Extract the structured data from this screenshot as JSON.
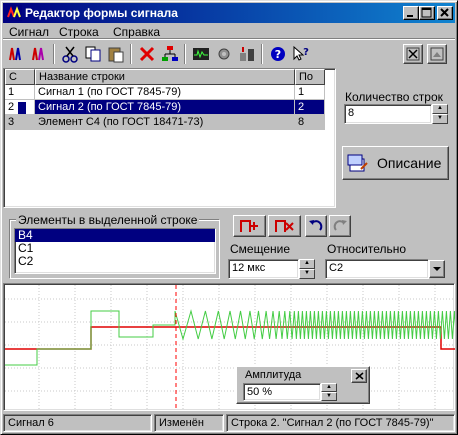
{
  "window": {
    "title": "Редактор формы сигнала"
  },
  "menu": [
    "Сигнал",
    "Строка",
    "Справка"
  ],
  "toolbar": {
    "icons": [
      "signal-add-icon",
      "signal-delete-icon",
      "cut-icon",
      "copy-icon",
      "paste-icon",
      "delete-icon",
      "tree-icon",
      "oscilloscope-icon",
      "settings-icon",
      "export-icon",
      "help-icon",
      "context-help-icon"
    ],
    "right_icons": [
      "close-panel-icon",
      "minimize-panel-icon"
    ]
  },
  "table": {
    "headers": [
      "С",
      "Название строки",
      "По"
    ],
    "rows": [
      {
        "c": "1",
        "name": "Сигнал 1 (по ГОСТ 7845-79)",
        "po": "1"
      },
      {
        "c": "2",
        "name": "Сигнал 2 (по ГОСТ 7845-79)",
        "po": "2",
        "selected": true
      },
      {
        "c": "3",
        "name": "Элемент С4 (по ГОСТ 18471-73)",
        "po": "8"
      }
    ]
  },
  "row_count": {
    "label": "Количество строк",
    "value": "8"
  },
  "description_button": "Описание",
  "elements_group": {
    "title": "Элементы в выделенной строке",
    "items": [
      "B4",
      "C1",
      "C2"
    ],
    "selected_index": 0
  },
  "offset": {
    "label": "Смещение",
    "value": "12 мкс"
  },
  "relative": {
    "label": "Относительно",
    "value": "C2"
  },
  "amplitude": {
    "title": "Амплитуда",
    "value": "50 %"
  },
  "status": {
    "signal": "Сигнал 6",
    "state": "Изменён",
    "row": "Строка 2. \"Сигнал 2 (по ГОСТ 7845-79)\""
  },
  "colors": {
    "title_start": "#000080",
    "title_end": "#1084d0",
    "selection": "#000080",
    "grid_green": "#44cc44",
    "signal_red": "#e00000",
    "marker_red": "#ff0000"
  }
}
